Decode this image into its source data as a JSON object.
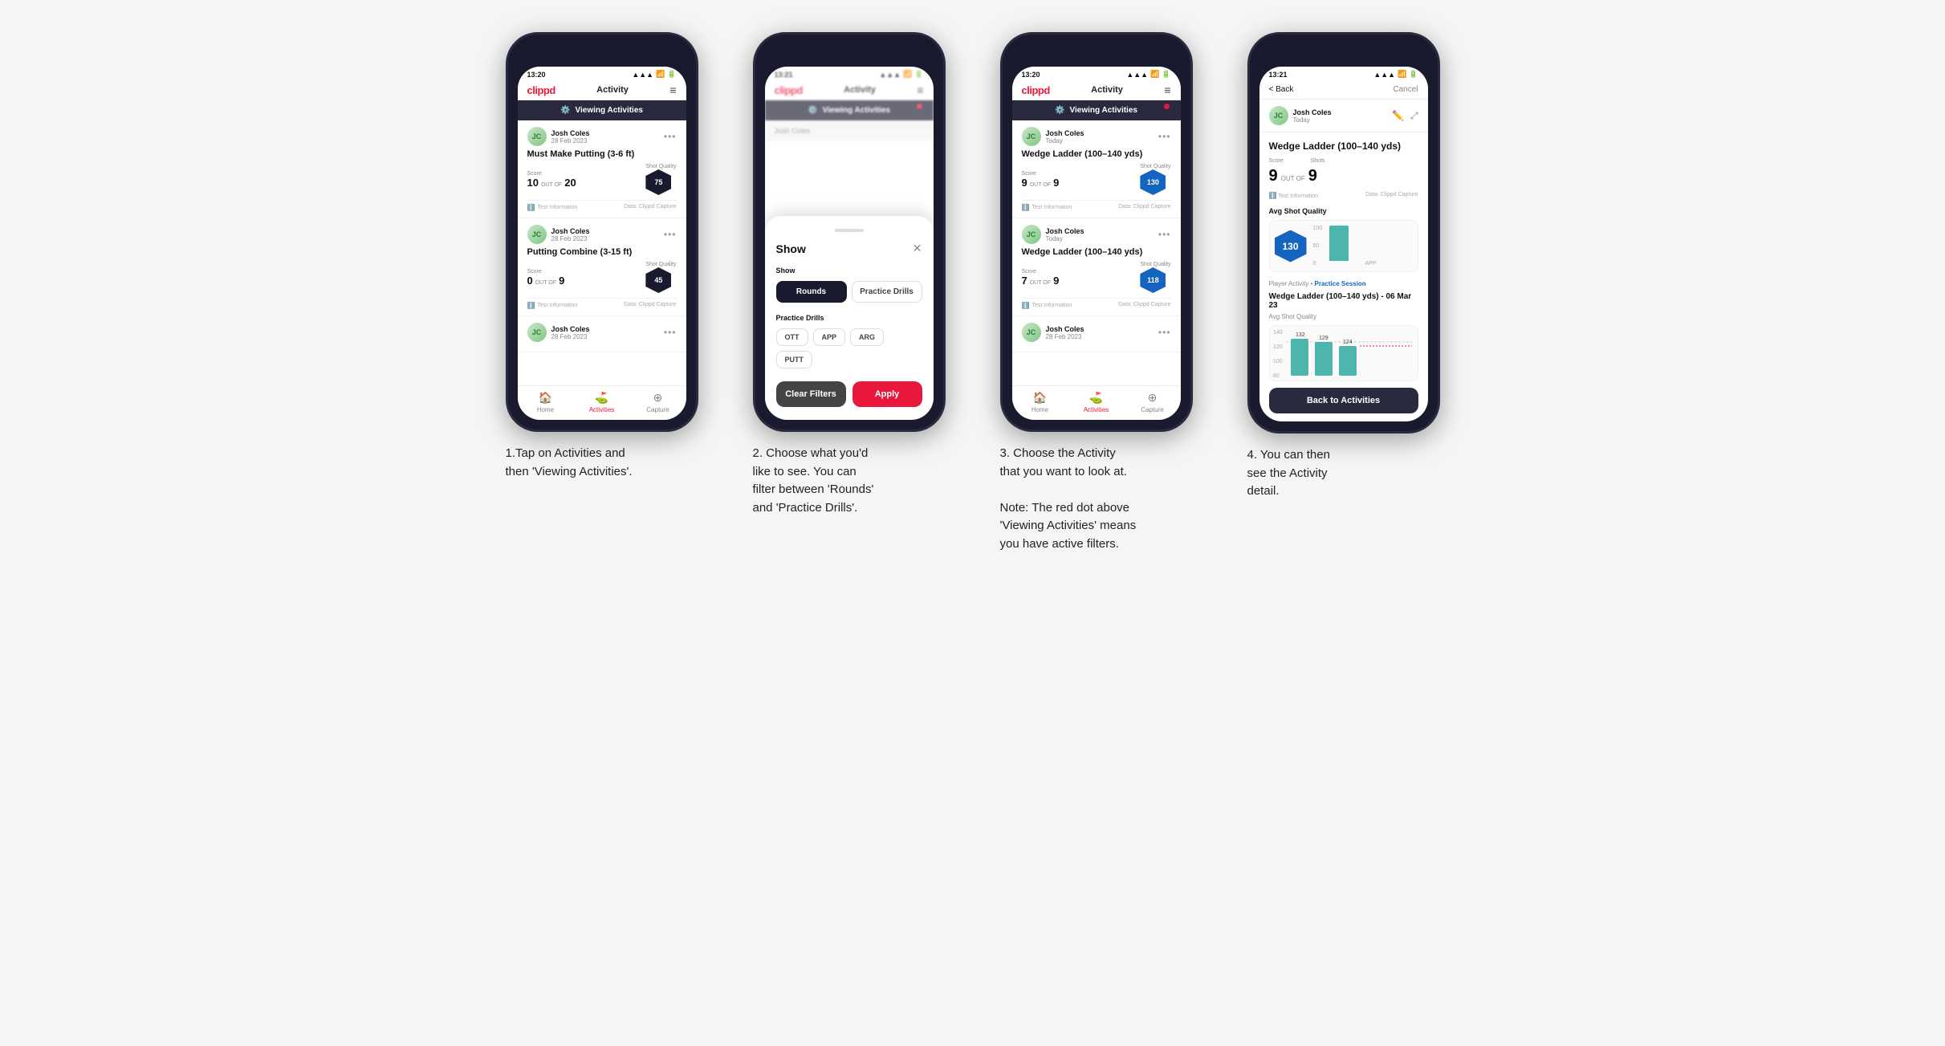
{
  "phones": [
    {
      "id": "phone1",
      "time": "13:20",
      "header": {
        "logo": "clippd",
        "title": "Activity",
        "menu": "≡"
      },
      "filter_banner": {
        "text": "Viewing Activities",
        "has_red_dot": false
      },
      "cards": [
        {
          "name": "Josh Coles",
          "date": "28 Feb 2023",
          "title": "Must Make Putting (3-6 ft)",
          "score_label": "Score",
          "shots_label": "Shots",
          "quality_label": "Shot Quality",
          "score": "10",
          "out_of": "OUT OF",
          "shots": "20",
          "quality": "75",
          "quality_type": "hex",
          "test_info": "Test Information",
          "data_source": "Data: Clippd Capture"
        },
        {
          "name": "Josh Coles",
          "date": "28 Feb 2023",
          "title": "Putting Combine (3-15 ft)",
          "score_label": "Score",
          "shots_label": "Shots",
          "quality_label": "Shot Quality",
          "score": "0",
          "out_of": "OUT OF",
          "shots": "9",
          "quality": "45",
          "quality_type": "hex",
          "test_info": "Test Information",
          "data_source": "Data: Clippd Capture"
        },
        {
          "name": "Josh Coles",
          "date": "28 Feb 2023",
          "title": "",
          "score": "",
          "shots": "",
          "quality": ""
        }
      ],
      "nav": [
        {
          "icon": "🏠",
          "label": "Home",
          "active": false
        },
        {
          "icon": "⛳",
          "label": "Activities",
          "active": true
        },
        {
          "icon": "➕",
          "label": "Capture",
          "active": false
        }
      ]
    },
    {
      "id": "phone2",
      "time": "13:21",
      "header": {
        "logo": "clippd",
        "title": "Activity",
        "menu": "≡"
      },
      "filter_banner": {
        "text": "Viewing Activities",
        "has_red_dot": true
      },
      "modal": {
        "show_label": "Show",
        "toggle_left": "Rounds",
        "toggle_right": "Practice Drills",
        "toggle_left_active": false,
        "toggle_right_active": true,
        "drills_label": "Practice Drills",
        "drills": [
          "OTT",
          "APP",
          "ARG",
          "PUTT"
        ],
        "clear_label": "Clear Filters",
        "apply_label": "Apply"
      }
    },
    {
      "id": "phone3",
      "time": "13:20",
      "header": {
        "logo": "clippd",
        "title": "Activity",
        "menu": "≡"
      },
      "filter_banner": {
        "text": "Viewing Activities",
        "has_red_dot": true
      },
      "cards": [
        {
          "name": "Josh Coles",
          "date": "Today",
          "title": "Wedge Ladder (100–140 yds)",
          "score_label": "Score",
          "shots_label": "Shots",
          "quality_label": "Shot Quality",
          "score": "9",
          "out_of": "OUT OF",
          "shots": "9",
          "quality": "130",
          "quality_type": "hex_blue",
          "test_info": "Test Information",
          "data_source": "Data: Clippd Capture"
        },
        {
          "name": "Josh Coles",
          "date": "Today",
          "title": "Wedge Ladder (100–140 yds)",
          "score_label": "Score",
          "shots_label": "Shots",
          "quality_label": "Shot Quality",
          "score": "7",
          "out_of": "OUT OF",
          "shots": "9",
          "quality": "118",
          "quality_type": "hex_blue",
          "test_info": "Test Information",
          "data_source": "Data: Clippd Capture"
        },
        {
          "name": "Josh Coles",
          "date": "28 Feb 2023",
          "title": "",
          "score": "",
          "shots": "",
          "quality": ""
        }
      ],
      "nav": [
        {
          "icon": "🏠",
          "label": "Home",
          "active": false
        },
        {
          "icon": "⛳",
          "label": "Activities",
          "active": true
        },
        {
          "icon": "➕",
          "label": "Capture",
          "active": false
        }
      ]
    },
    {
      "id": "phone4",
      "time": "13:21",
      "back_label": "< Back",
      "cancel_label": "Cancel",
      "user": {
        "name": "Josh Coles",
        "date": "Today"
      },
      "detail_title": "Wedge Ladder (100–140 yds)",
      "score_label": "Score",
      "shots_label": "Shots",
      "score": "9",
      "out_of": "OUT OF",
      "shots": "9",
      "test_info": "Test Information",
      "data_source": "Data: Clippd Capture",
      "quality_label": "Avg Shot Quality",
      "quality_val": "130",
      "chart_bars": [
        {
          "label": "APP",
          "height": 45
        }
      ],
      "chart_y": [
        100,
        50,
        0
      ],
      "chart_y_labels": [
        "100",
        "50",
        "0"
      ],
      "session_label": "Player Activity",
      "session_type": "Practice Session",
      "sub_title": "Wedge Ladder (100–140 yds) - 06 Mar 23",
      "sub_subtitle": "Avg Shot Quality",
      "bar_values": [
        132,
        129,
        124
      ],
      "back_to_label": "Back to Activities"
    }
  ],
  "captions": [
    "1.Tap on Activities and\nthen 'Viewing Activities'.",
    "2. Choose what you'd\nlike to see. You can\nfilter between 'Rounds'\nand 'Practice Drills'.",
    "3. Choose the Activity\nthat you want to look at.\n\nNote: The red dot above\n'Viewing Activities' means\nyou have active filters.",
    "4. You can then\nsee the Activity\ndetail."
  ]
}
